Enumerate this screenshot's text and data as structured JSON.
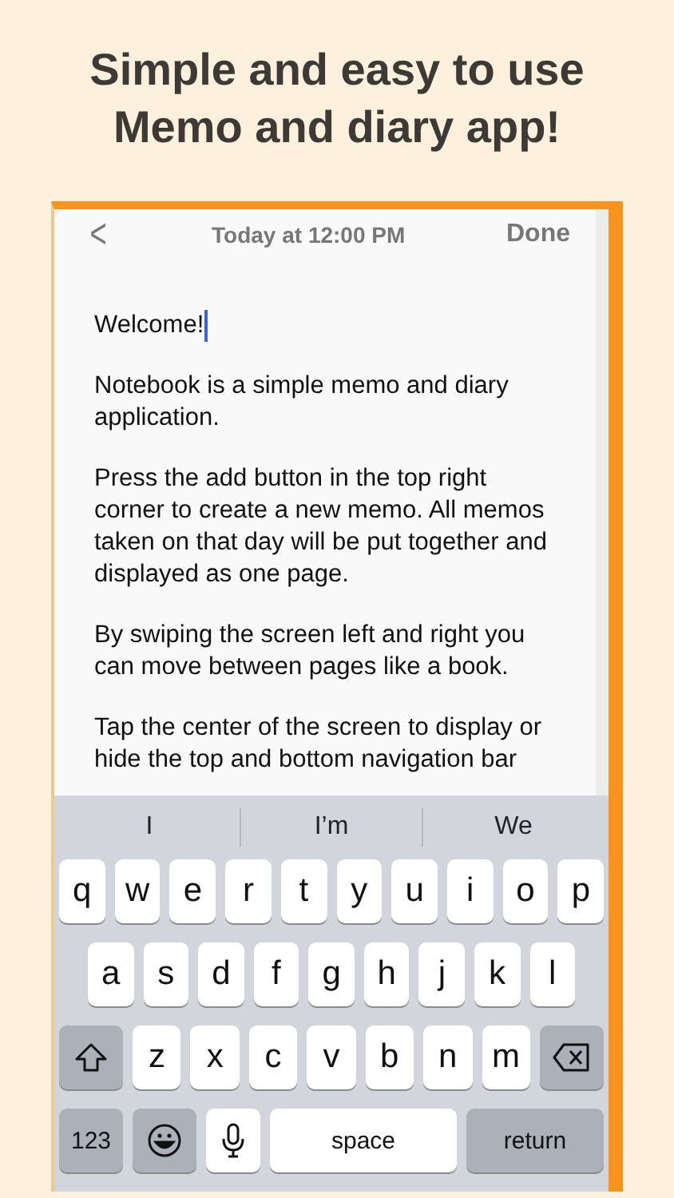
{
  "headline": [
    "Simple and easy to use",
    "Memo and diary app!"
  ],
  "note": {
    "back": "<",
    "date": "Today at 12:00 PM",
    "done": "Done",
    "paragraphs": [
      "Welcome!",
      "Notebook is a simple memo and diary application.",
      "Press the add button in the top right corner to create a new memo. All memos taken on that day will be put together and displayed as one page.",
      "By swiping the screen left and right you can move between pages like a book.",
      "Tap the center of the screen to display or hide the top and bottom navigation bar"
    ]
  },
  "keyboard": {
    "suggestions": [
      "I",
      "I’m",
      "We"
    ],
    "rows": [
      [
        {
          "kind": "letter",
          "label": "q"
        },
        {
          "kind": "letter",
          "label": "w"
        },
        {
          "kind": "letter",
          "label": "e"
        },
        {
          "kind": "letter",
          "label": "r"
        },
        {
          "kind": "letter",
          "label": "t"
        },
        {
          "kind": "letter",
          "label": "y"
        },
        {
          "kind": "letter",
          "label": "u"
        },
        {
          "kind": "letter",
          "label": "i"
        },
        {
          "kind": "letter",
          "label": "o"
        },
        {
          "kind": "letter",
          "label": "p"
        }
      ],
      [
        {
          "kind": "letter",
          "label": "a"
        },
        {
          "kind": "letter",
          "label": "s"
        },
        {
          "kind": "letter",
          "label": "d"
        },
        {
          "kind": "letter",
          "label": "f"
        },
        {
          "kind": "letter",
          "label": "g"
        },
        {
          "kind": "letter",
          "label": "h"
        },
        {
          "kind": "letter",
          "label": "j"
        },
        {
          "kind": "letter",
          "label": "k"
        },
        {
          "kind": "letter",
          "label": "l"
        }
      ],
      [
        {
          "kind": "shift"
        },
        {
          "kind": "letter",
          "label": "z"
        },
        {
          "kind": "letter",
          "label": "x"
        },
        {
          "kind": "letter",
          "label": "c"
        },
        {
          "kind": "letter",
          "label": "v"
        },
        {
          "kind": "letter",
          "label": "b"
        },
        {
          "kind": "letter",
          "label": "n"
        },
        {
          "kind": "letter",
          "label": "m"
        },
        {
          "kind": "delete"
        }
      ]
    ],
    "bottom_row": {
      "numbers": "123",
      "space": "space",
      "return": "return"
    }
  }
}
